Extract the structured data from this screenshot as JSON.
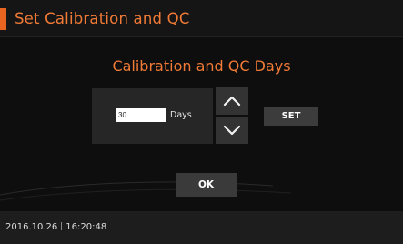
{
  "header": {
    "title": "Set Calibration and QC",
    "accent_color": "#e8641f"
  },
  "main": {
    "heading": "Calibration and QC Days",
    "days_input": {
      "value": "30"
    },
    "days_unit": "Days",
    "stepper": {
      "up_icon": "chevron-up-icon",
      "down_icon": "chevron-down-icon"
    },
    "set_label": "SET",
    "ok_label": "OK"
  },
  "status": {
    "date": "2016.10.26",
    "time": "16:20:48"
  },
  "colors": {
    "title_text": "#f07a36",
    "background": "#0e0e0e",
    "button": "#3c3c3c"
  }
}
